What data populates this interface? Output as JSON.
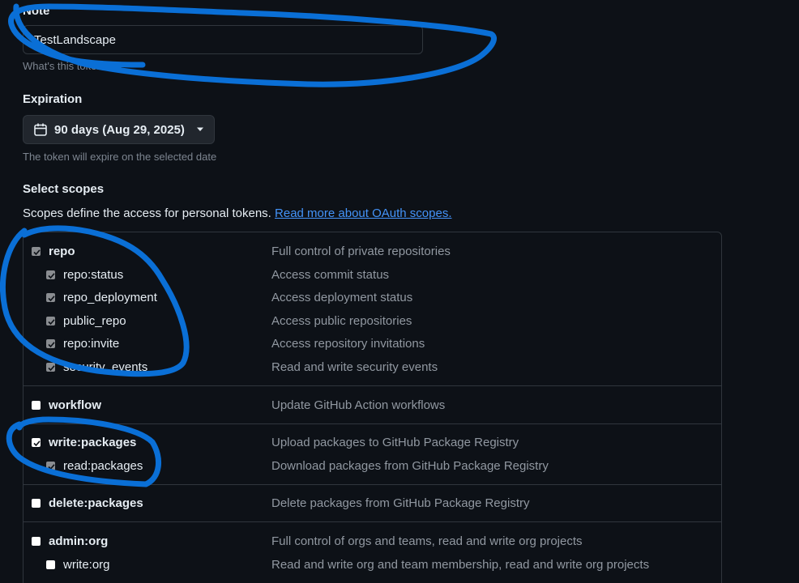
{
  "note": {
    "label": "Note",
    "value": "TestLandscape",
    "hint": "What's this token for?"
  },
  "expiration": {
    "label": "Expiration",
    "selected": "90 days (Aug 29, 2025)",
    "hint": "The token will expire on the selected date"
  },
  "scopes": {
    "title": "Select scopes",
    "description": "Scopes define the access for personal tokens.",
    "link": "Read more about OAuth scopes.",
    "rows": [
      {
        "name": "repo",
        "desc": "Full control of private repositories",
        "checked": true
      },
      {
        "name": "repo:status",
        "desc": "Access commit status",
        "checked": true
      },
      {
        "name": "repo_deployment",
        "desc": "Access deployment status",
        "checked": true
      },
      {
        "name": "public_repo",
        "desc": "Access public repositories",
        "checked": true
      },
      {
        "name": "repo:invite",
        "desc": "Access repository invitations",
        "checked": true
      },
      {
        "name": "security_events",
        "desc": "Read and write security events",
        "checked": true
      },
      {
        "name": "workflow",
        "desc": "Update GitHub Action workflows",
        "checked": false
      },
      {
        "name": "write:packages",
        "desc": "Upload packages to GitHub Package Registry",
        "checked": true
      },
      {
        "name": "read:packages",
        "desc": "Download packages from GitHub Package Registry",
        "checked": true
      },
      {
        "name": "delete:packages",
        "desc": "Delete packages from GitHub Package Registry",
        "checked": false
      },
      {
        "name": "admin:org",
        "desc": "Full control of orgs and teams, read and write org projects",
        "checked": false
      },
      {
        "name": "write:org",
        "desc": "Read and write org and team membership, read and write org projects",
        "checked": false
      }
    ]
  },
  "icons": {
    "calendar": "calendar-icon",
    "dropdown": "triangle-down-icon",
    "check": "check-icon"
  },
  "colors": {
    "background": "#0d1117",
    "border": "#30363d",
    "link": "#4493f8",
    "annotation": "#0a6fd6"
  }
}
